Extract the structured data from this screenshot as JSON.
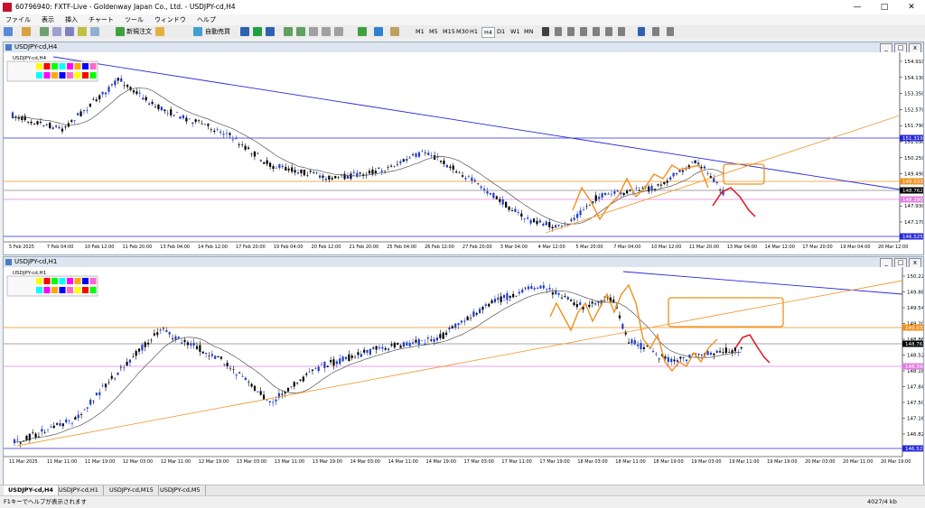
{
  "window": {
    "title": "60796940: FXTF-Live - Goldenway Japan Co., Ltd. - USDJPY-cd,H4"
  },
  "menu": [
    "ファイル",
    "表示",
    "挿入",
    "チャート",
    "ツール",
    "ウィンドウ",
    "ヘルプ"
  ],
  "toolbar": {
    "new_order": "新規注文",
    "auto_trade": "自動売買",
    "timeframes": [
      "M1",
      "M5",
      "M15",
      "M30",
      "H1",
      "H4",
      "D1",
      "W1",
      "MN"
    ],
    "active_timeframe": "H4"
  },
  "chart_h4": {
    "window_label": "USDJPY-cd,H4",
    "symbol_label": "USDJPY-cd,H4",
    "price_labels": [
      "154.910",
      "154.130",
      "153.350",
      "152.570",
      "151.790",
      "151.030",
      "150.250",
      "149.490",
      "148.710",
      "147.930",
      "147.170"
    ],
    "hline_labels": {
      "blue_top": "151.319",
      "orange_a": "149.033",
      "current": "148.762",
      "pink": "148.390",
      "blue_bottom": "146.525"
    },
    "time_labels": [
      "5 Feb 2025",
      "7 Feb 04:00",
      "10 Feb 12:00",
      "11 Feb 20:00",
      "13 Feb 04:00",
      "14 Feb 12:00",
      "17 Feb 20:00",
      "19 Feb 04:00",
      "20 Feb 12:00",
      "21 Feb 20:00",
      "25 Feb 04:00",
      "26 Feb 12:00",
      "27 Feb 20:00",
      "3 Mar 04:00",
      "4 Mar 12:00",
      "5 Mar 20:00",
      "7 Mar 04:00",
      "10 Mar 12:00",
      "11 Mar 20:00",
      "13 Mar 04:00",
      "14 Mar 12:00",
      "17 Mar 20:00",
      "19 Mar 04:00",
      "20 Mar 12:00"
    ]
  },
  "chart_h1": {
    "window_label": "USDJPY-cd,H1",
    "symbol_label": "USDJPY-cd,H1",
    "price_labels": [
      "150.220",
      "149.880",
      "149.540",
      "149.200",
      "148.860",
      "148.520",
      "148.180",
      "147.840",
      "147.500",
      "147.160",
      "146.820"
    ],
    "hline_labels": {
      "orange_a": "149.033",
      "current": "148.762",
      "pink": "148.390",
      "blue_bottom": "146.525"
    },
    "time_labels": [
      "11 Mar 2025",
      "11 Mar 11:00",
      "11 Mar 19:00",
      "12 Mar 03:00",
      "12 Mar 11:00",
      "12 Mar 19:00",
      "13 Mar 03:00",
      "13 Mar 11:00",
      "13 Mar 19:00",
      "14 Mar 03:00",
      "14 Mar 11:00",
      "14 Mar 19:00",
      "17 Mar 03:00",
      "17 Mar 11:00",
      "17 Mar 19:00",
      "18 Mar 03:00",
      "18 Mar 11:00",
      "18 Mar 19:00",
      "19 Mar 03:00",
      "19 Mar 11:00",
      "19 Mar 19:00",
      "20 Mar 03:00",
      "20 Mar 11:00",
      "20 Mar 19:00"
    ]
  },
  "tabs": [
    "USDJPY-cd,H4",
    "USDJPY-cd,H1",
    "USDJPY-cd,M15",
    "USDJPY-cd,M5"
  ],
  "active_tab": "USDJPY-cd,H4",
  "status": {
    "left": "F1キーでヘルプが表示されます",
    "right": "4027/4 kb"
  },
  "colors": {
    "up": "#000000",
    "down": "#1e3cc8",
    "ma": "#555555",
    "orange": "#f0901e",
    "red": "#e0141e",
    "trend_blue": "#2828dc",
    "pink": "#e080e0"
  }
}
